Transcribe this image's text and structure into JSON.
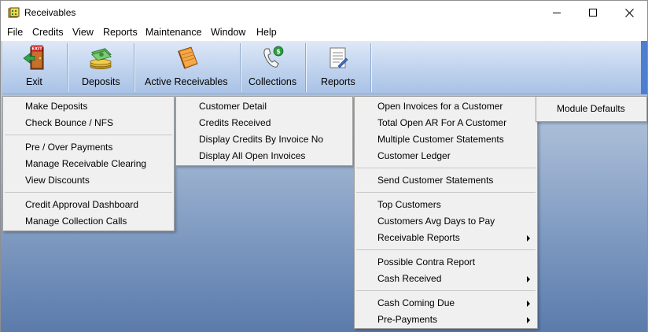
{
  "window": {
    "title": "Receivables",
    "icon": "ledger-app-icon"
  },
  "menubar": [
    "File",
    "Credits",
    "View",
    "Reports",
    "Maintenance",
    "Window",
    "Help"
  ],
  "toolbar": {
    "exit": "Exit",
    "deposits": "Deposits",
    "active_receivables": "Active Receivables",
    "collections": "Collections",
    "reports": "Reports",
    "exit_sign_text": "EXIT"
  },
  "menus": {
    "deposits": [
      "Make Deposits",
      "Check Bounce / NFS",
      "Pre /  Over Payments",
      "Manage Receivable Clearing",
      "View Discounts",
      "Credit Approval Dashboard",
      "Manage Collection Calls"
    ],
    "active_receivables": [
      "Customer Detail",
      "Credits Received",
      "Display Credits By Invoice No",
      "Display All Open Invoices"
    ],
    "collections": [
      "Open Invoices for a Customer",
      "Total Open AR For A Customer",
      "Multiple Customer Statements",
      "Customer Ledger",
      "Send Customer Statements",
      "Top Customers",
      "Customers Avg Days to Pay",
      "Receivable Reports",
      "Possible Contra Report",
      "Cash Received",
      "Cash Coming Due",
      "Pre-Payments"
    ],
    "reports": [
      "Module Defaults"
    ]
  },
  "colors": {
    "toolbar_top": "#dfe9f7",
    "toolbar_bottom": "#a8c2e6",
    "desktop_bottom": "#5b7bab",
    "menu_bg": "#f0f0f0"
  }
}
